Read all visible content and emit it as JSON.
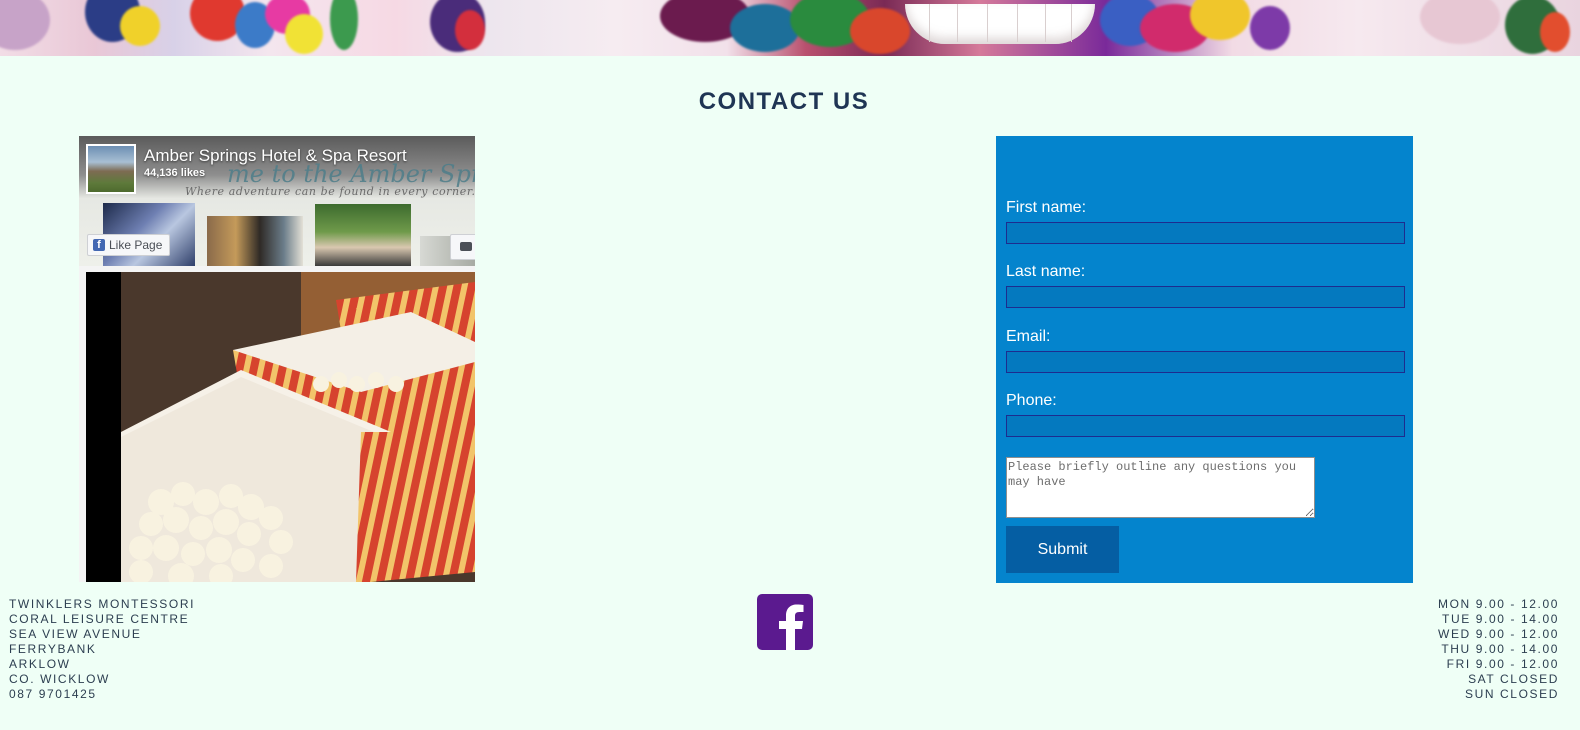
{
  "colors": {
    "page_background": "#effff6",
    "heading": "#1f3554",
    "form_background": "#0484cd",
    "submit_button": "#055ea3",
    "facebook_brand": "#4267b2",
    "footer_facebook_icon": "#5b1a8f",
    "footer_text": "#2c3e50"
  },
  "banner": {
    "icon": "painted-lips-photo"
  },
  "section": {
    "title": "CONTACT US"
  },
  "facebook_widget": {
    "page_name": "Amber Springs Hotel & Spa Resort",
    "likes": "44,136 likes",
    "cover_script": "me to the Amber Sprin",
    "cover_tagline": "Where adventure can be found in every corner...",
    "like_button_label": "Like Page",
    "like_button_icon": "facebook-f-icon",
    "message_button_icon": "message-icon",
    "post_photo": "popcorn-boxes-photo"
  },
  "form": {
    "fields": [
      {
        "label": "First name:",
        "value": ""
      },
      {
        "label": "Last name:",
        "value": ""
      },
      {
        "label": "Email:",
        "value": ""
      },
      {
        "label": "Phone:",
        "value": ""
      }
    ],
    "message_placeholder": "Please briefly outline any questions you may have",
    "submit_label": "Submit"
  },
  "footer": {
    "address_lines": [
      "TWINKLERS MONTESSORI",
      "CORAL LEISURE CENTRE",
      "SEA VIEW AVENUE",
      "FERRYBANK",
      "ARKLOW",
      "CO. WICKLOW",
      "087 9701425"
    ],
    "facebook_icon": "facebook-icon",
    "hours": [
      "MON 9.00 - 12.00",
      "TUE 9.00 - 14.00",
      "WED 9.00 - 12.00",
      "THU 9.00 - 14.00",
      "FRI 9.00 - 12.00",
      "SAT CLOSED",
      "SUN CLOSED"
    ]
  }
}
